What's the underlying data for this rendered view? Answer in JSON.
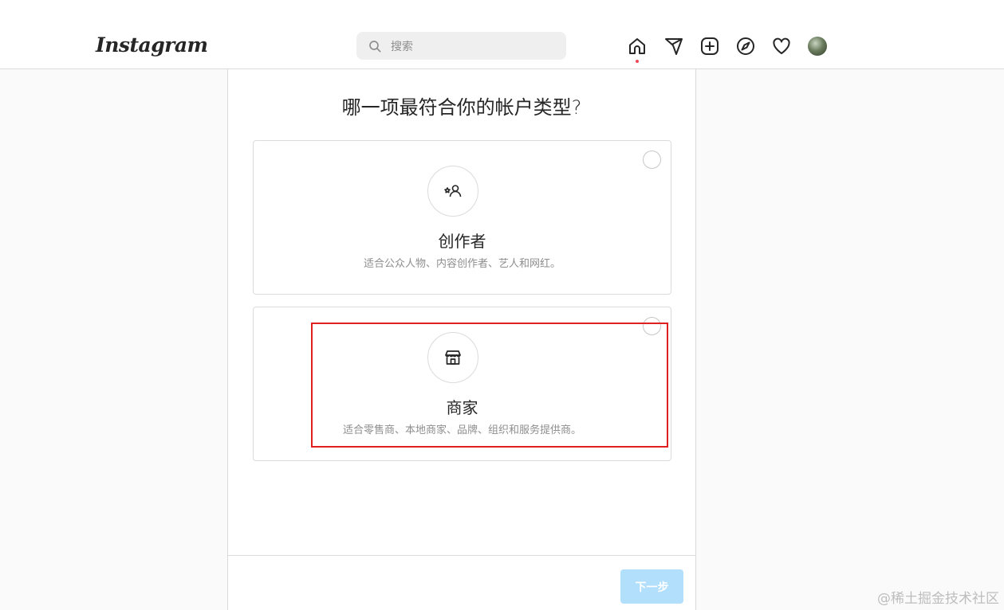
{
  "header": {
    "logo_text": "Instagram",
    "search_placeholder": "搜索"
  },
  "nav": {
    "icons": [
      "home-icon",
      "direct-message-icon",
      "new-post-icon",
      "explore-icon",
      "activity-heart-icon",
      "profile-avatar"
    ]
  },
  "dialog": {
    "title": "哪一项最符合你的帐户类型?",
    "options": [
      {
        "title": "创作者",
        "description": "适合公众人物、内容创作者、艺人和网红。",
        "icon": "creator-icon"
      },
      {
        "title": "商家",
        "description": "适合零售商、本地商家、品牌、组织和服务提供商。",
        "icon": "shop-icon"
      }
    ],
    "next_label": "下一步"
  },
  "watermark": "@稀土掘金技术社区",
  "colors": {
    "accent": "#b2dffc",
    "highlight": "#e02020",
    "notification": "#ed4956"
  }
}
